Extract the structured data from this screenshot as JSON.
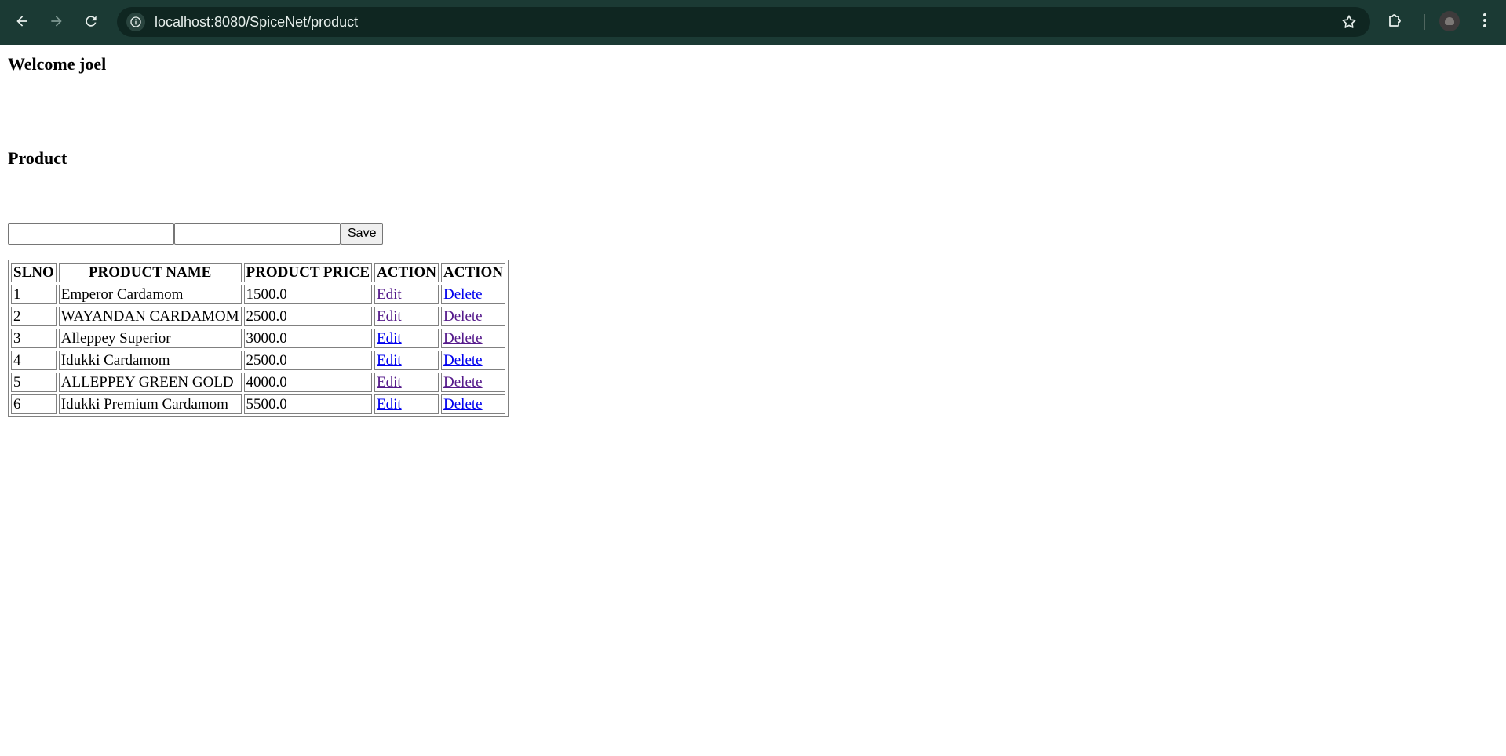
{
  "browser": {
    "url": "localhost:8080/SpiceNet/product",
    "back_icon": "arrow-left-icon",
    "forward_icon": "arrow-right-icon",
    "reload_icon": "reload-icon"
  },
  "page": {
    "welcome": "Welcome joel",
    "heading": "Product",
    "form": {
      "name_value": "",
      "price_value": "",
      "save_label": "Save"
    }
  },
  "table": {
    "headers": [
      "SLNO",
      "PRODUCT NAME",
      "PRODUCT PRICE",
      "ACTION",
      "ACTION"
    ],
    "rows": [
      {
        "slno": "1",
        "name": "Emperor Cardamom",
        "price": "1500.0",
        "edit": "Edit",
        "delete": "Delete",
        "edit_visited": true,
        "delete_visited": false
      },
      {
        "slno": "2",
        "name": "WAYANDAN CARDAMOM",
        "price": "2500.0",
        "edit": "Edit",
        "delete": "Delete",
        "edit_visited": true,
        "delete_visited": true
      },
      {
        "slno": "3",
        "name": "Alleppey Superior",
        "price": "3000.0",
        "edit": "Edit",
        "delete": "Delete",
        "edit_visited": false,
        "delete_visited": true
      },
      {
        "slno": "4",
        "name": "Idukki Cardamom",
        "price": "2500.0",
        "edit": "Edit",
        "delete": "Delete",
        "edit_visited": false,
        "delete_visited": false
      },
      {
        "slno": "5",
        "name": "ALLEPPEY GREEN GOLD",
        "price": "4000.0",
        "edit": "Edit",
        "delete": "Delete",
        "edit_visited": true,
        "delete_visited": true
      },
      {
        "slno": "6",
        "name": "Idukki Premium Cardamom",
        "price": "5500.0",
        "edit": "Edit",
        "delete": "Delete",
        "edit_visited": false,
        "delete_visited": false
      }
    ]
  },
  "colors": {
    "toolbar_bg": "#1b3a34",
    "omnibox_bg": "#0f2621",
    "link": "#0000ee",
    "link_visited": "#551a8b"
  }
}
